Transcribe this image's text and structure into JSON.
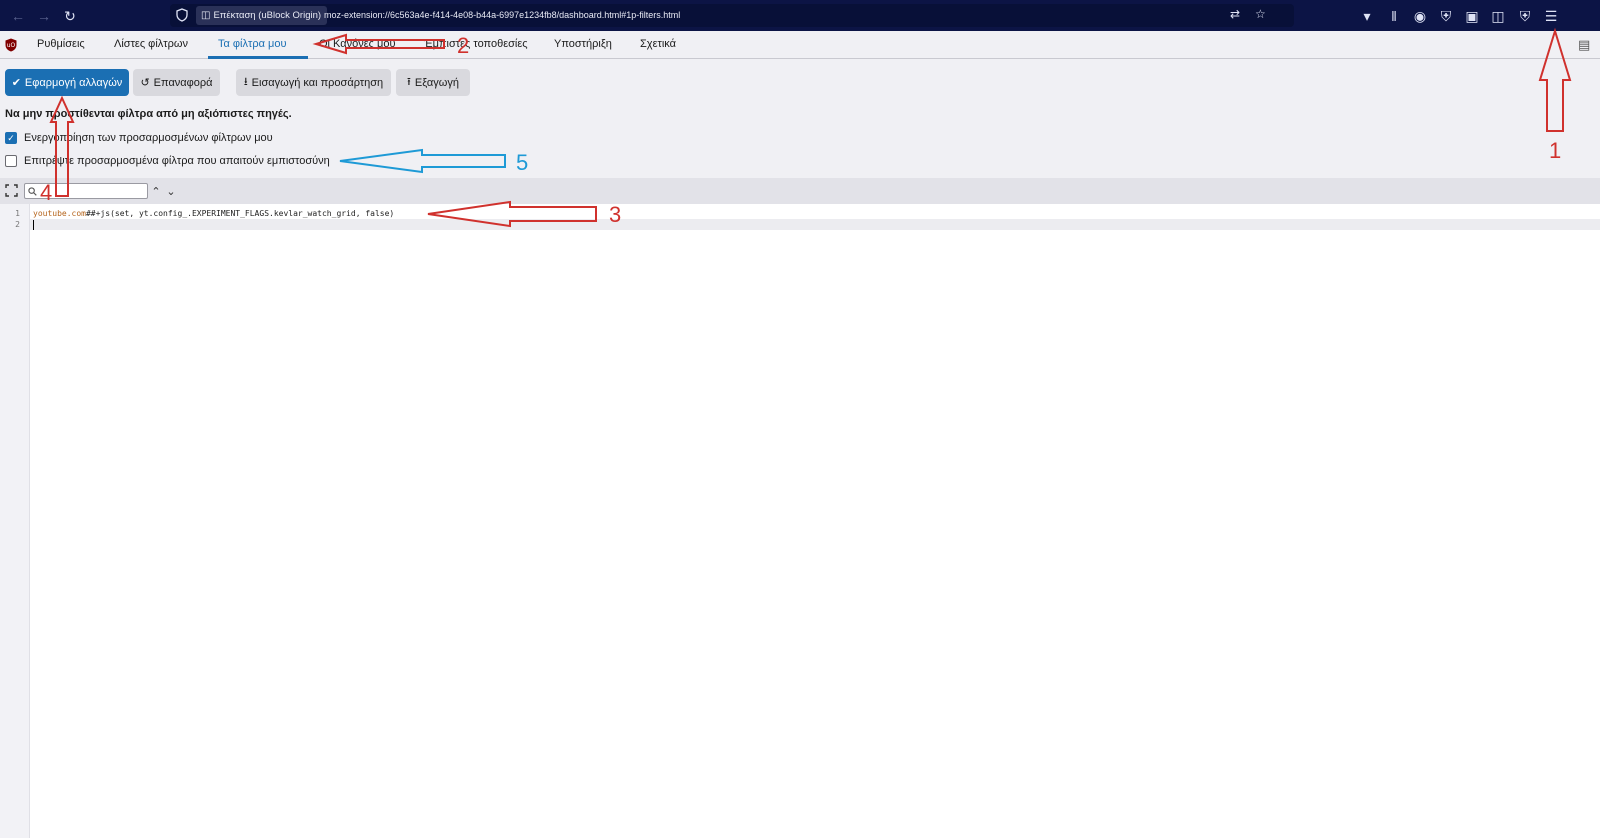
{
  "browser": {
    "extension_chip": "Επέκταση (uBlock Origin)",
    "url": "moz-extension://6c563a4e-f414-4e08-b44a-6997e1234fb8/dashboard.html#1p-filters.html"
  },
  "tabs": [
    {
      "label": "Ρυθμίσεις",
      "active": false
    },
    {
      "label": "Λίστες φίλτρων",
      "active": false
    },
    {
      "label": "Τα φίλτρα μου",
      "active": true
    },
    {
      "label": "Οι Κανόνες μου",
      "active": false
    },
    {
      "label": "Έμπιστες τοποθεσίες",
      "active": false
    },
    {
      "label": "Υποστήριξη",
      "active": false
    },
    {
      "label": "Σχετικά",
      "active": false
    }
  ],
  "actions": {
    "apply": "Εφαρμογή αλλαγών",
    "revert": "Επαναφορά",
    "import": "Εισαγωγή και προσάρτηση",
    "export": "Εξαγωγή"
  },
  "notice": "Να μην προστίθενται φίλτρα από μη αξιόπιστες πηγές.",
  "options": {
    "enable_custom": {
      "label": "Ενεργοποίηση των προσαρμοσμένων φίλτρων μου",
      "checked": true
    },
    "allow_trusted": {
      "label": "Επιτρέψτε προσαρμοσμένα φίλτρα που απαιτούν εμπιστοσύνη",
      "checked": false
    }
  },
  "search": {
    "value": ""
  },
  "editor": {
    "lines": [
      {
        "number": "1",
        "domain": "youtube.com",
        "rest": "##+js(set, yt.config_.EXPERIMENT_FLAGS.kevlar_watch_grid, false)"
      },
      {
        "number": "2",
        "domain": "",
        "rest": ""
      }
    ]
  },
  "annotations": {
    "labels": [
      "1",
      "2",
      "3",
      "4",
      "5"
    ],
    "red": "#d0312d",
    "blue": "#1e9ad6"
  },
  "colors": {
    "accent": "#1b6fb3",
    "toolbar": "#0c1445",
    "domain_text": "#b5651d"
  }
}
